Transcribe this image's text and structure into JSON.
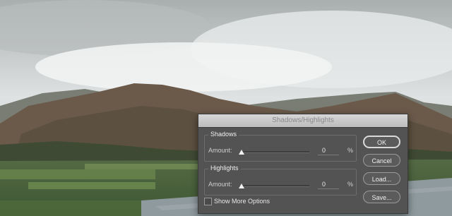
{
  "dialog": {
    "title": "Shadows/Highlights",
    "shadows": {
      "group_label": "Shadows",
      "amount_label": "Amount:",
      "amount_value": "0",
      "unit": "%",
      "slider_fraction": 0
    },
    "highlights": {
      "group_label": "Highlights",
      "amount_label": "Amount:",
      "amount_value": "0",
      "unit": "%",
      "slider_fraction": 0
    },
    "show_more_options_label": "Show More Options",
    "show_more_options_checked": false,
    "buttons": {
      "ok": "OK",
      "cancel": "Cancel",
      "load": "Load...",
      "save": "Save..."
    }
  }
}
